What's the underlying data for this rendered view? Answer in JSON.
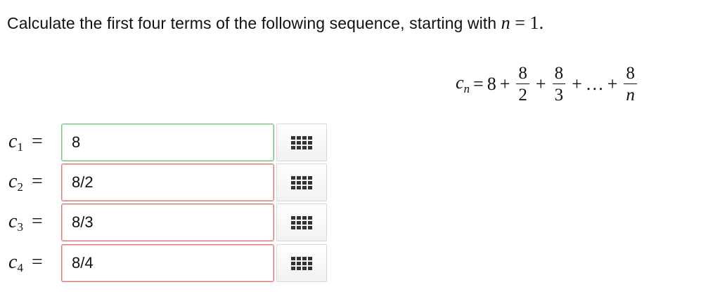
{
  "question": {
    "text": "Calculate the first four terms of the following sequence, starting with",
    "n_var": "n",
    "equals": "=",
    "start_value": "1."
  },
  "formula": {
    "lhs": "c",
    "lhs_subscript": "n",
    "equals": "=",
    "constant": "8",
    "plus": "+",
    "ellipsis": "…",
    "terms": [
      {
        "numerator": "8",
        "denominator": "2"
      },
      {
        "numerator": "8",
        "denominator": "3"
      },
      {
        "numerator": "8",
        "denominator": "n"
      }
    ]
  },
  "answers": [
    {
      "var": "c",
      "subscript": "1",
      "equals": "=",
      "value": "8",
      "state": "correct"
    },
    {
      "var": "c",
      "subscript": "2",
      "equals": "=",
      "value": "8/2",
      "state": "incorrect"
    },
    {
      "var": "c",
      "subscript": "3",
      "equals": "=",
      "value": "8/3",
      "state": "incorrect"
    },
    {
      "var": "c",
      "subscript": "4",
      "equals": "=",
      "value": "8/4",
      "state": "incorrect"
    }
  ],
  "palette_icon": "keypad-grid-icon",
  "colors": {
    "correct_border": "#7fc77f",
    "incorrect_border": "#d97b7b"
  }
}
